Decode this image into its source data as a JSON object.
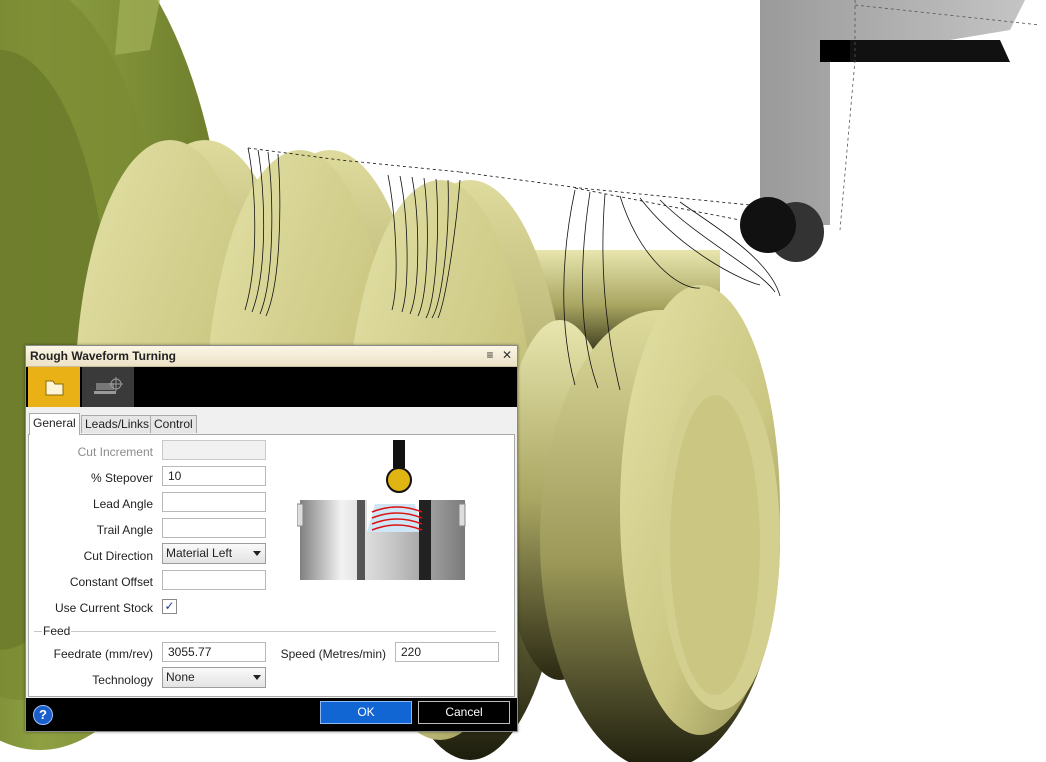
{
  "dialog": {
    "title": "Rough Waveform Turning",
    "tabs": [
      {
        "label": "General"
      },
      {
        "label": "Leads/Links"
      },
      {
        "label": "Control"
      }
    ],
    "fields": {
      "cut_increment": {
        "label": "Cut Increment",
        "value": ""
      },
      "stepover": {
        "label": "% Stepover",
        "value": "10"
      },
      "lead_angle": {
        "label": "Lead Angle",
        "value": ""
      },
      "trail_angle": {
        "label": "Trail Angle",
        "value": ""
      },
      "cut_direction": {
        "label": "Cut Direction",
        "value": "Material Left"
      },
      "constant_offset": {
        "label": "Constant Offset",
        "value": ""
      },
      "use_current_stock": {
        "label": "Use Current Stock",
        "checked": true,
        "check_glyph": "✓"
      }
    },
    "feed": {
      "section_label": "Feed",
      "feedrate": {
        "label": "Feedrate (mm/rev)",
        "value": "3055.77"
      },
      "speed": {
        "label": "Speed (Metres/min)",
        "value": "220"
      },
      "technology": {
        "label": "Technology",
        "value": "None"
      }
    },
    "buttons": {
      "ok": "OK",
      "cancel": "Cancel",
      "help": "?"
    },
    "icons": {
      "titlebar_menu": "≡",
      "titlebar_close": "✕"
    }
  },
  "colors": {
    "accent_tab": "#e9b116",
    "ok_button": "#1266d4",
    "part_body": "#cdca85",
    "chuck": "#7f9036"
  }
}
